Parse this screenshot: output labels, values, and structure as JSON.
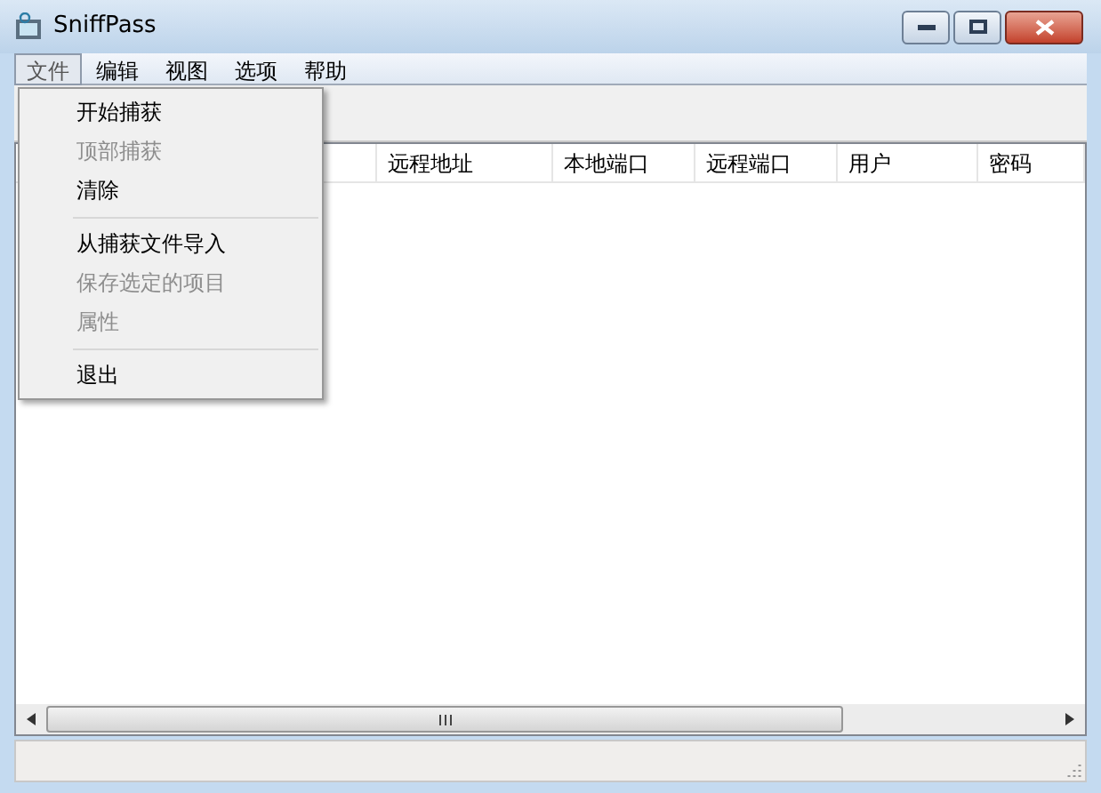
{
  "window": {
    "title": "SniffPass"
  },
  "menu_bar": [
    {
      "label": "文件",
      "selected": true
    },
    {
      "label": "编辑",
      "selected": false
    },
    {
      "label": "视图",
      "selected": false
    },
    {
      "label": "选项",
      "selected": false
    },
    {
      "label": "帮助",
      "selected": false
    }
  ],
  "file_menu": [
    {
      "kind": "item",
      "label": "开始捕获",
      "disabled": false
    },
    {
      "kind": "item",
      "label": "顶部捕获",
      "disabled": true
    },
    {
      "kind": "item",
      "label": "清除",
      "disabled": false
    },
    {
      "kind": "separator"
    },
    {
      "kind": "item",
      "label": "从捕获文件导入",
      "disabled": false
    },
    {
      "kind": "item",
      "label": "保存选定的项目",
      "disabled": true
    },
    {
      "kind": "item",
      "label": "属性",
      "disabled": true
    },
    {
      "kind": "separator"
    },
    {
      "kind": "item",
      "label": "退出",
      "disabled": false
    }
  ],
  "table": {
    "columns": [
      "远程地址",
      "本地端口",
      "远程端口",
      "用户",
      "密码"
    ]
  }
}
